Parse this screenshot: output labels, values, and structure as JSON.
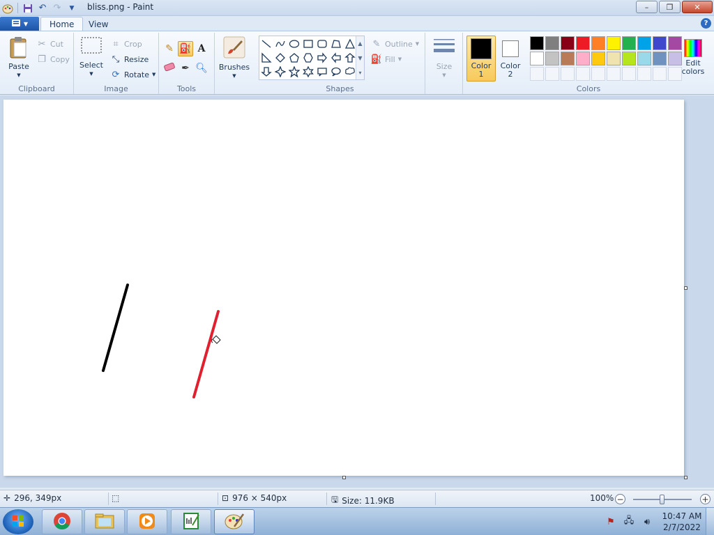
{
  "window": {
    "title": "bliss.png - Paint",
    "minimize_label": "–",
    "maximize_label": "❐",
    "close_label": "✕"
  },
  "tabs": {
    "menu_icon": "paint-menu-icon",
    "home": "Home",
    "view": "View",
    "help_label": "?"
  },
  "ribbon": {
    "clipboard": {
      "label": "Clipboard",
      "paste": "Paste",
      "cut": "Cut",
      "copy": "Copy"
    },
    "image": {
      "label": "Image",
      "select": "Select",
      "crop": "Crop",
      "resize": "Resize",
      "rotate": "Rotate"
    },
    "tools": {
      "label": "Tools"
    },
    "brushes": {
      "label": "Brushes"
    },
    "shapes": {
      "label": "Shapes",
      "outline": "Outline",
      "fill": "Fill"
    },
    "size": {
      "label": "Size"
    },
    "colors": {
      "label": "Colors",
      "color1": "Color",
      "color1_num": "1",
      "color2": "Color",
      "color2_num": "2",
      "edit": "Edit",
      "edit2": "colors",
      "color1_value": "#000000",
      "color2_value": "#ffffff",
      "palette_row1": [
        "#000000",
        "#7f7f7f",
        "#880015",
        "#ed1c24",
        "#ff7f27",
        "#fff200",
        "#22b14c",
        "#00a2e8",
        "#3f48cc",
        "#a349a4"
      ],
      "palette_row2": [
        "#ffffff",
        "#c3c3c3",
        "#b97a57",
        "#ffaec9",
        "#ffc90e",
        "#efe4b0",
        "#b5e61d",
        "#99d9ea",
        "#7092be",
        "#c8bfe7"
      ]
    }
  },
  "canvas": {
    "strokes": [
      {
        "color": "#000000"
      },
      {
        "color": "#e0202e"
      }
    ]
  },
  "status": {
    "cursor_pos": "296, 349px",
    "image_size": "976 × 540px",
    "file_size": "Size: 11.9KB",
    "zoom": "100%"
  },
  "taskbar": {
    "apps": [
      "chrome-icon",
      "file-explorer-icon",
      "media-player-icon",
      "notepad-icon",
      "paint-icon"
    ],
    "time": "10:47 AM",
    "date": "2/7/2022"
  }
}
